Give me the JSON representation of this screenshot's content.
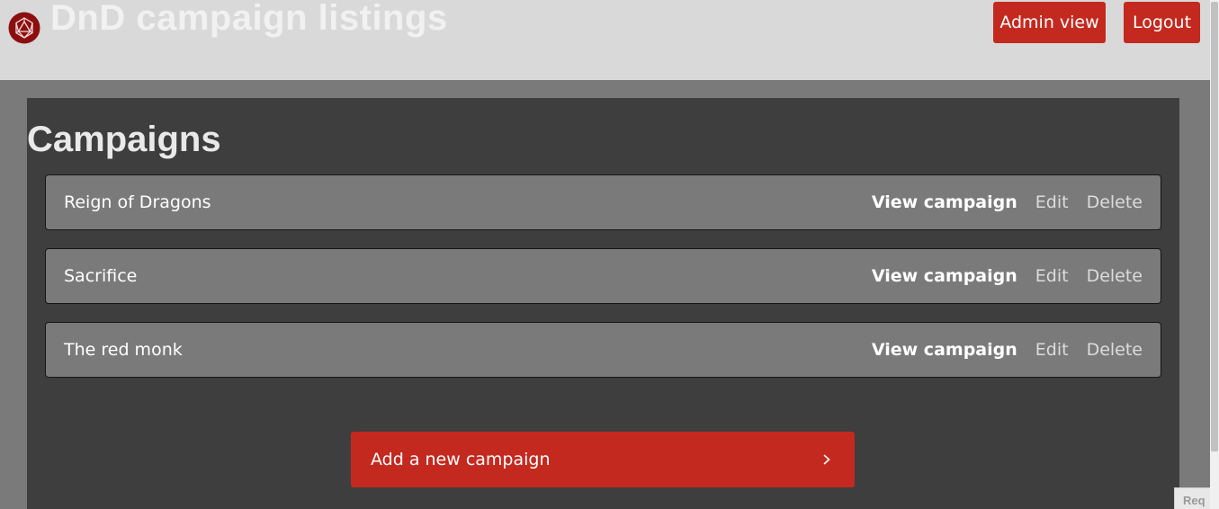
{
  "header": {
    "title": "DnD campaign listings",
    "logo_icon": "d20-dice-icon",
    "admin_label": "Admin view",
    "logout_label": "Logout"
  },
  "main": {
    "heading": "Campaigns",
    "campaigns": [
      {
        "name": "Reign of Dragons",
        "view_label": "View campaign",
        "edit_label": "Edit",
        "delete_label": "Delete"
      },
      {
        "name": "Sacrifice",
        "view_label": "View campaign",
        "edit_label": "Edit",
        "delete_label": "Delete"
      },
      {
        "name": "The red monk",
        "view_label": "View campaign",
        "edit_label": "Edit",
        "delete_label": "Delete"
      }
    ],
    "add_label": "Add a new campaign",
    "add_icon": "chevron-right-icon"
  },
  "corner_badge": {
    "text": "Req"
  },
  "colors": {
    "accent": "#c4291f",
    "header_bg": "#d9d9d9",
    "page_bg": "#7a7a7a",
    "panel_bg": "#3e3e3e",
    "row_bg": "#7a7a7a"
  }
}
